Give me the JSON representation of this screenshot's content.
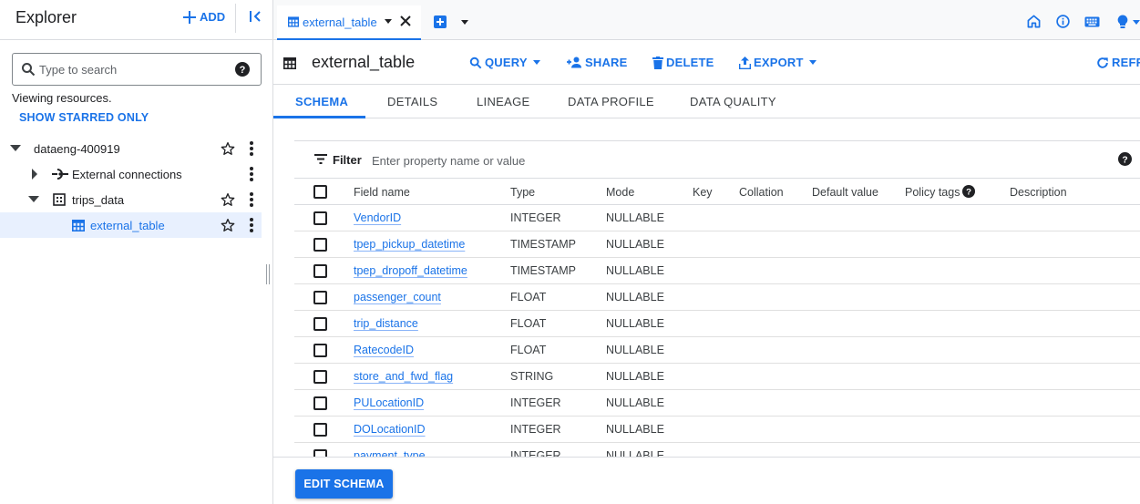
{
  "explorer": {
    "title": "Explorer",
    "add_label": "ADD",
    "search_placeholder": "Type to search",
    "viewing_text": "Viewing resources.",
    "show_starred_label": "SHOW STARRED ONLY",
    "tree": {
      "project": "dataeng-400919",
      "external_connections": "External connections",
      "dataset": "trips_data",
      "table": "external_table"
    }
  },
  "tabs": {
    "active_tab_label": "external_table"
  },
  "toolbar": {
    "title": "external_table",
    "query_label": "QUERY",
    "share_label": "SHARE",
    "delete_label": "DELETE",
    "export_label": "EXPORT",
    "refresh_label": "REFR"
  },
  "subtabs": {
    "schema": "SCHEMA",
    "details": "DETAILS",
    "lineage": "LINEAGE",
    "data_profile": "DATA PROFILE",
    "data_quality": "DATA QUALITY"
  },
  "filter": {
    "label": "Filter",
    "placeholder": "Enter property name or value"
  },
  "schema_table": {
    "headers": {
      "field_name": "Field name",
      "type": "Type",
      "mode": "Mode",
      "key": "Key",
      "collation": "Collation",
      "default_value": "Default value",
      "policy_tags": "Policy tags",
      "description": "Description"
    },
    "rows": [
      {
        "name": "VendorID",
        "type": "INTEGER",
        "mode": "NULLABLE"
      },
      {
        "name": "tpep_pickup_datetime",
        "type": "TIMESTAMP",
        "mode": "NULLABLE"
      },
      {
        "name": "tpep_dropoff_datetime",
        "type": "TIMESTAMP",
        "mode": "NULLABLE"
      },
      {
        "name": "passenger_count",
        "type": "FLOAT",
        "mode": "NULLABLE"
      },
      {
        "name": "trip_distance",
        "type": "FLOAT",
        "mode": "NULLABLE"
      },
      {
        "name": "RatecodeID",
        "type": "FLOAT",
        "mode": "NULLABLE"
      },
      {
        "name": "store_and_fwd_flag",
        "type": "STRING",
        "mode": "NULLABLE"
      },
      {
        "name": "PULocationID",
        "type": "INTEGER",
        "mode": "NULLABLE"
      },
      {
        "name": "DOLocationID",
        "type": "INTEGER",
        "mode": "NULLABLE"
      },
      {
        "name": "payment_type",
        "type": "INTEGER",
        "mode": "NULLABLE"
      }
    ]
  },
  "footer": {
    "edit_schema_label": "EDIT SCHEMA"
  },
  "colors": {
    "accent": "#1a73e8",
    "selected_row_bg": "#e8f0fe",
    "border": "#dadce0"
  },
  "icons": {
    "add": "plus-icon",
    "collapse": "collapse-panel-icon",
    "search": "search-icon",
    "help": "help-icon",
    "star": "star-outline-icon",
    "more": "more-vert-icon",
    "table": "table-icon",
    "dataset": "dataset-icon",
    "connection": "connection-icon",
    "home": "home-icon",
    "info": "info-icon",
    "keyboard": "keyboard-icon",
    "tips": "lightbulb-icon"
  }
}
